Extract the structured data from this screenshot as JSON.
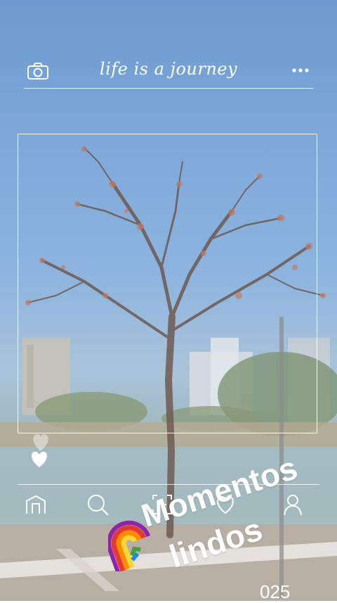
{
  "header": {
    "title": "life is a journey",
    "camera_icon": "camera-icon",
    "more_icon": "more-dots-icon"
  },
  "post": {
    "frame": "photo-frame",
    "like_icon": "heart-icon"
  },
  "bottom_nav": {
    "items": [
      {
        "icon": "home-icon"
      },
      {
        "icon": "search-icon"
      },
      {
        "icon": "add-post-icon"
      },
      {
        "icon": "heart-icon"
      },
      {
        "icon": "profile-icon"
      }
    ]
  },
  "sticker": {
    "emoji_icon": "rainbow-icon",
    "line1": "Momentos",
    "line2": "lindos"
  },
  "year_fragment": "025",
  "colors": {
    "sky": "#7ba6d8",
    "outline": "#ffffff",
    "water": "#9db5b8"
  }
}
